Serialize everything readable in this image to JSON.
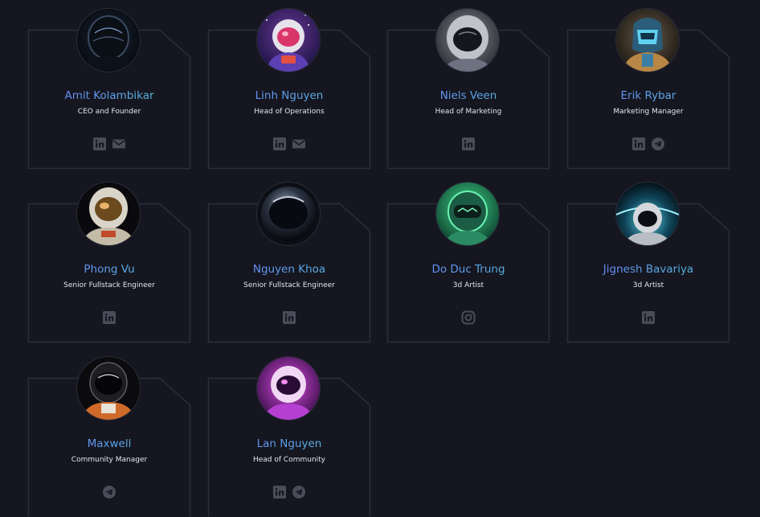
{
  "colors": {
    "background": "#15161f",
    "card_border": "#2b2e3b",
    "name_gradient_start": "#6b7cff",
    "name_gradient_end": "#4fc8d9",
    "role_text": "#e4e6ec",
    "social_icon": "#4a4d59"
  },
  "members": [
    {
      "name": "Amit Kolambikar",
      "role": "CEO and Founder",
      "avatar": "astronaut-dark-helmet",
      "socials": [
        "linkedin-icon",
        "mail-icon"
      ]
    },
    {
      "name": "Linh Nguyen",
      "role": "Head of Operations",
      "avatar": "astronaut-red-pink",
      "socials": [
        "linkedin-icon",
        "mail-icon"
      ]
    },
    {
      "name": "Niels Veen",
      "role": "Head of Marketing",
      "avatar": "astronaut-silver-helmet",
      "socials": [
        "linkedin-icon"
      ]
    },
    {
      "name": "Erik Rybar",
      "role": "Marketing Manager",
      "avatar": "astronaut-cyan-mech",
      "socials": [
        "linkedin-icon",
        "telegram-icon"
      ]
    },
    {
      "name": "Phong Vu",
      "role": "Senior Fullstack Engineer",
      "avatar": "astronaut-gold-visor",
      "socials": [
        "linkedin-icon"
      ]
    },
    {
      "name": "Nguyen Khoa",
      "role": "Senior Fullstack Engineer",
      "avatar": "astronaut-black-glass",
      "socials": [
        "linkedin-icon"
      ]
    },
    {
      "name": "Do Duc Trung",
      "role": "3d Artist",
      "avatar": "astronaut-green-visor",
      "socials": [
        "instagram-icon"
      ]
    },
    {
      "name": "Jignesh Bavariya",
      "role": "3d Artist",
      "avatar": "astronaut-planet-horizon",
      "socials": [
        "linkedin-icon"
      ]
    },
    {
      "name": "Maxwell",
      "role": "Community Manager",
      "avatar": "astronaut-orange-suit",
      "socials": [
        "telegram-icon"
      ]
    },
    {
      "name": "Lan Nguyen",
      "role": "Head of Community",
      "avatar": "astronaut-purple-glow",
      "socials": [
        "linkedin-icon",
        "telegram-icon"
      ]
    }
  ]
}
